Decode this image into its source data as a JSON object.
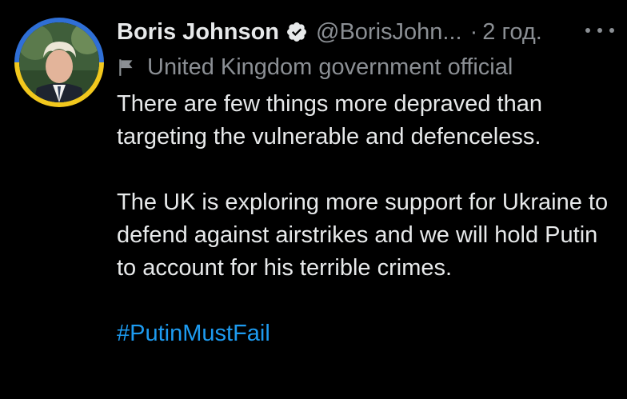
{
  "author": {
    "name": "Boris Johnson",
    "handle": "@BorisJohn...",
    "separator": "·",
    "time": "2 год."
  },
  "label": {
    "icon": "flag-icon",
    "text": "United Kingdom government official"
  },
  "tweet": {
    "paragraphs": [
      "There are few things more depraved than targeting the vulnerable and defenceless.",
      "The UK is exploring more support for Ukraine to defend against airstrikes and we will hold Putin to account for his terrible crimes."
    ],
    "hashtag": "#PutinMustFail"
  },
  "icons": {
    "verified": "verified-badge-icon",
    "more": "more-options-icon"
  },
  "colors": {
    "background": "#000000",
    "text": "#e7e9ea",
    "muted": "#8b8f94",
    "link": "#1d9bf0",
    "avatar_ring_top": "#2f6fd6",
    "avatar_ring_bottom": "#f2c81d"
  }
}
